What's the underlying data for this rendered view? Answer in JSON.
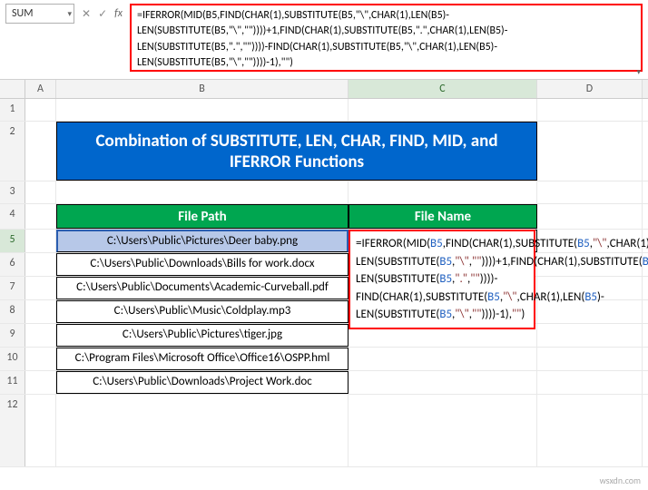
{
  "namebox": "SUM",
  "fb_btns": {
    "cancel": "✕",
    "confirm": "✓"
  },
  "formula_bar": "=IFERROR(MID(B5,FIND(CHAR(1),SUBSTITUTE(B5,\"\\\",CHAR(1),LEN(B5)-LEN(SUBSTITUTE(B5,\"\\\",\"\"))))+1,FIND(CHAR(1),SUBSTITUTE(B5,\".\",CHAR(1),LEN(B5)-LEN(SUBSTITUTE(B5,\".\",\"\"))))-FIND(CHAR(1),SUBSTITUTE(B5,\"\\\",CHAR(1),LEN(B5)-LEN(SUBSTITUTE(B5,\"\\\",\"\"))))-1),\"\")",
  "cols": {
    "A": "A",
    "B": "B",
    "C": "C",
    "D": "D"
  },
  "rows": [
    "1",
    "2",
    "3",
    "4",
    "5",
    "6",
    "7",
    "8",
    "9",
    "10",
    "11",
    "12"
  ],
  "title": "Combination of SUBSTITUTE, LEN, CHAR, FIND, MID, and IFERROR Functions",
  "headers": {
    "path": "File Path",
    "name": "File Name"
  },
  "paths": [
    "C:\\Users\\Public\\Pictures\\Deer baby.png",
    "C:\\Users\\Public\\Downloads\\Bills for work.docx",
    "C:\\Users\\Public\\Documents\\Academic-Curveball.pdf",
    "C:\\Users\\Public\\Music\\Coldplay.mp3",
    "C:\\Users\\Public\\Pictures\\tiger.jpg",
    "C:\\Program Files\\Microsoft Office\\Office16\\OSPP.hml",
    "C:\\Users\\Public\\Downloads\\Project Work.doc"
  ],
  "overlay_tokens": [
    {
      "t": "=IFERROR",
      "c": "fn"
    },
    {
      "t": "(",
      "c": "fn"
    },
    {
      "t": "MID",
      "c": "fn"
    },
    {
      "t": "(",
      "c": "fn"
    },
    {
      "t": "B5",
      "c": "ref"
    },
    {
      "t": ",",
      "c": "fn"
    },
    {
      "t": "FIND",
      "c": "fn"
    },
    {
      "t": "(",
      "c": "fn"
    },
    {
      "t": "CHAR",
      "c": "fn"
    },
    {
      "t": "(",
      "c": "fn"
    },
    {
      "t": "1",
      "c": "num"
    },
    {
      "t": "),",
      "c": "fn"
    },
    {
      "t": "SUBSTITUTE",
      "c": "fn"
    },
    {
      "t": "(",
      "c": "fn"
    },
    {
      "t": "B5",
      "c": "ref"
    },
    {
      "t": ",",
      "c": "fn"
    },
    {
      "t": "\"\\\"",
      "c": "str"
    },
    {
      "t": ",",
      "c": "fn"
    },
    {
      "t": "CHAR",
      "c": "fn"
    },
    {
      "t": "(",
      "c": "fn"
    },
    {
      "t": "1",
      "c": "num"
    },
    {
      "t": "),",
      "c": "fn"
    },
    {
      "t": "LEN",
      "c": "fn"
    },
    {
      "t": "(",
      "c": "fn"
    },
    {
      "t": "B5",
      "c": "ref"
    },
    {
      "t": ")-",
      "c": "fn"
    },
    {
      "t": "LEN",
      "c": "fn"
    },
    {
      "t": "(",
      "c": "fn"
    },
    {
      "t": "SUBSTITUTE",
      "c": "fn"
    },
    {
      "t": "(",
      "c": "fn"
    },
    {
      "t": "B5",
      "c": "ref"
    },
    {
      "t": ",",
      "c": "fn"
    },
    {
      "t": "\"\\\"",
      "c": "str"
    },
    {
      "t": ",",
      "c": "fn"
    },
    {
      "t": "\"\"",
      "c": "str"
    },
    {
      "t": "))))+",
      "c": "fn"
    },
    {
      "t": "1",
      "c": "num"
    },
    {
      "t": ",",
      "c": "fn"
    },
    {
      "t": "FIND",
      "c": "fn"
    },
    {
      "t": "(",
      "c": "fn"
    },
    {
      "t": "CHAR",
      "c": "fn"
    },
    {
      "t": "(",
      "c": "fn"
    },
    {
      "t": "1",
      "c": "num"
    },
    {
      "t": "),",
      "c": "fn"
    },
    {
      "t": "SUBSTITUTE",
      "c": "fn"
    },
    {
      "t": "(",
      "c": "fn"
    },
    {
      "t": "B5",
      "c": "ref"
    },
    {
      "t": ",",
      "c": "fn"
    },
    {
      "t": "\".\"",
      "c": "str"
    },
    {
      "t": ",",
      "c": "fn"
    },
    {
      "t": "CHAR",
      "c": "fn"
    },
    {
      "t": "(",
      "c": "fn"
    },
    {
      "t": "1",
      "c": "num"
    },
    {
      "t": "),",
      "c": "fn"
    },
    {
      "t": "LEN",
      "c": "fn"
    },
    {
      "t": "(",
      "c": "fn"
    },
    {
      "t": "B5",
      "c": "ref"
    },
    {
      "t": ")-",
      "c": "fn"
    },
    {
      "t": "LEN",
      "c": "fn"
    },
    {
      "t": "(",
      "c": "fn"
    },
    {
      "t": "SUBSTITUTE",
      "c": "fn"
    },
    {
      "t": "(",
      "c": "fn"
    },
    {
      "t": "B5",
      "c": "ref"
    },
    {
      "t": ",",
      "c": "fn"
    },
    {
      "t": "\".\"",
      "c": "str"
    },
    {
      "t": ",",
      "c": "fn"
    },
    {
      "t": "\"\"",
      "c": "str"
    },
    {
      "t": "))))-",
      "c": "fn"
    },
    {
      "t": "FIND",
      "c": "fn"
    },
    {
      "t": "(",
      "c": "fn"
    },
    {
      "t": "CHAR",
      "c": "fn"
    },
    {
      "t": "(",
      "c": "fn"
    },
    {
      "t": "1",
      "c": "num"
    },
    {
      "t": "),",
      "c": "fn"
    },
    {
      "t": "SUBSTITUTE",
      "c": "fn"
    },
    {
      "t": "(",
      "c": "fn"
    },
    {
      "t": "B5",
      "c": "ref"
    },
    {
      "t": ",",
      "c": "fn"
    },
    {
      "t": "\"\\\"",
      "c": "str"
    },
    {
      "t": ",",
      "c": "fn"
    },
    {
      "t": "CHAR",
      "c": "fn"
    },
    {
      "t": "(",
      "c": "fn"
    },
    {
      "t": "1",
      "c": "num"
    },
    {
      "t": "),",
      "c": "fn"
    },
    {
      "t": "LEN",
      "c": "fn"
    },
    {
      "t": "(",
      "c": "fn"
    },
    {
      "t": "B5",
      "c": "ref"
    },
    {
      "t": ")-",
      "c": "fn"
    },
    {
      "t": "LEN",
      "c": "fn"
    },
    {
      "t": "(",
      "c": "fn"
    },
    {
      "t": "SUBSTITUTE",
      "c": "fn"
    },
    {
      "t": "(",
      "c": "fn"
    },
    {
      "t": "B5",
      "c": "ref"
    },
    {
      "t": ",",
      "c": "fn"
    },
    {
      "t": "\"\\\"",
      "c": "str"
    },
    {
      "t": ",",
      "c": "fn"
    },
    {
      "t": "\"\"",
      "c": "str"
    },
    {
      "t": "))))-",
      "c": "fn"
    },
    {
      "t": "1",
      "c": "num"
    },
    {
      "t": "),",
      "c": "fn"
    },
    {
      "t": "\"\"",
      "c": "str"
    },
    {
      "t": ")",
      "c": "fn"
    }
  ],
  "watermark": "wsxdn.com"
}
